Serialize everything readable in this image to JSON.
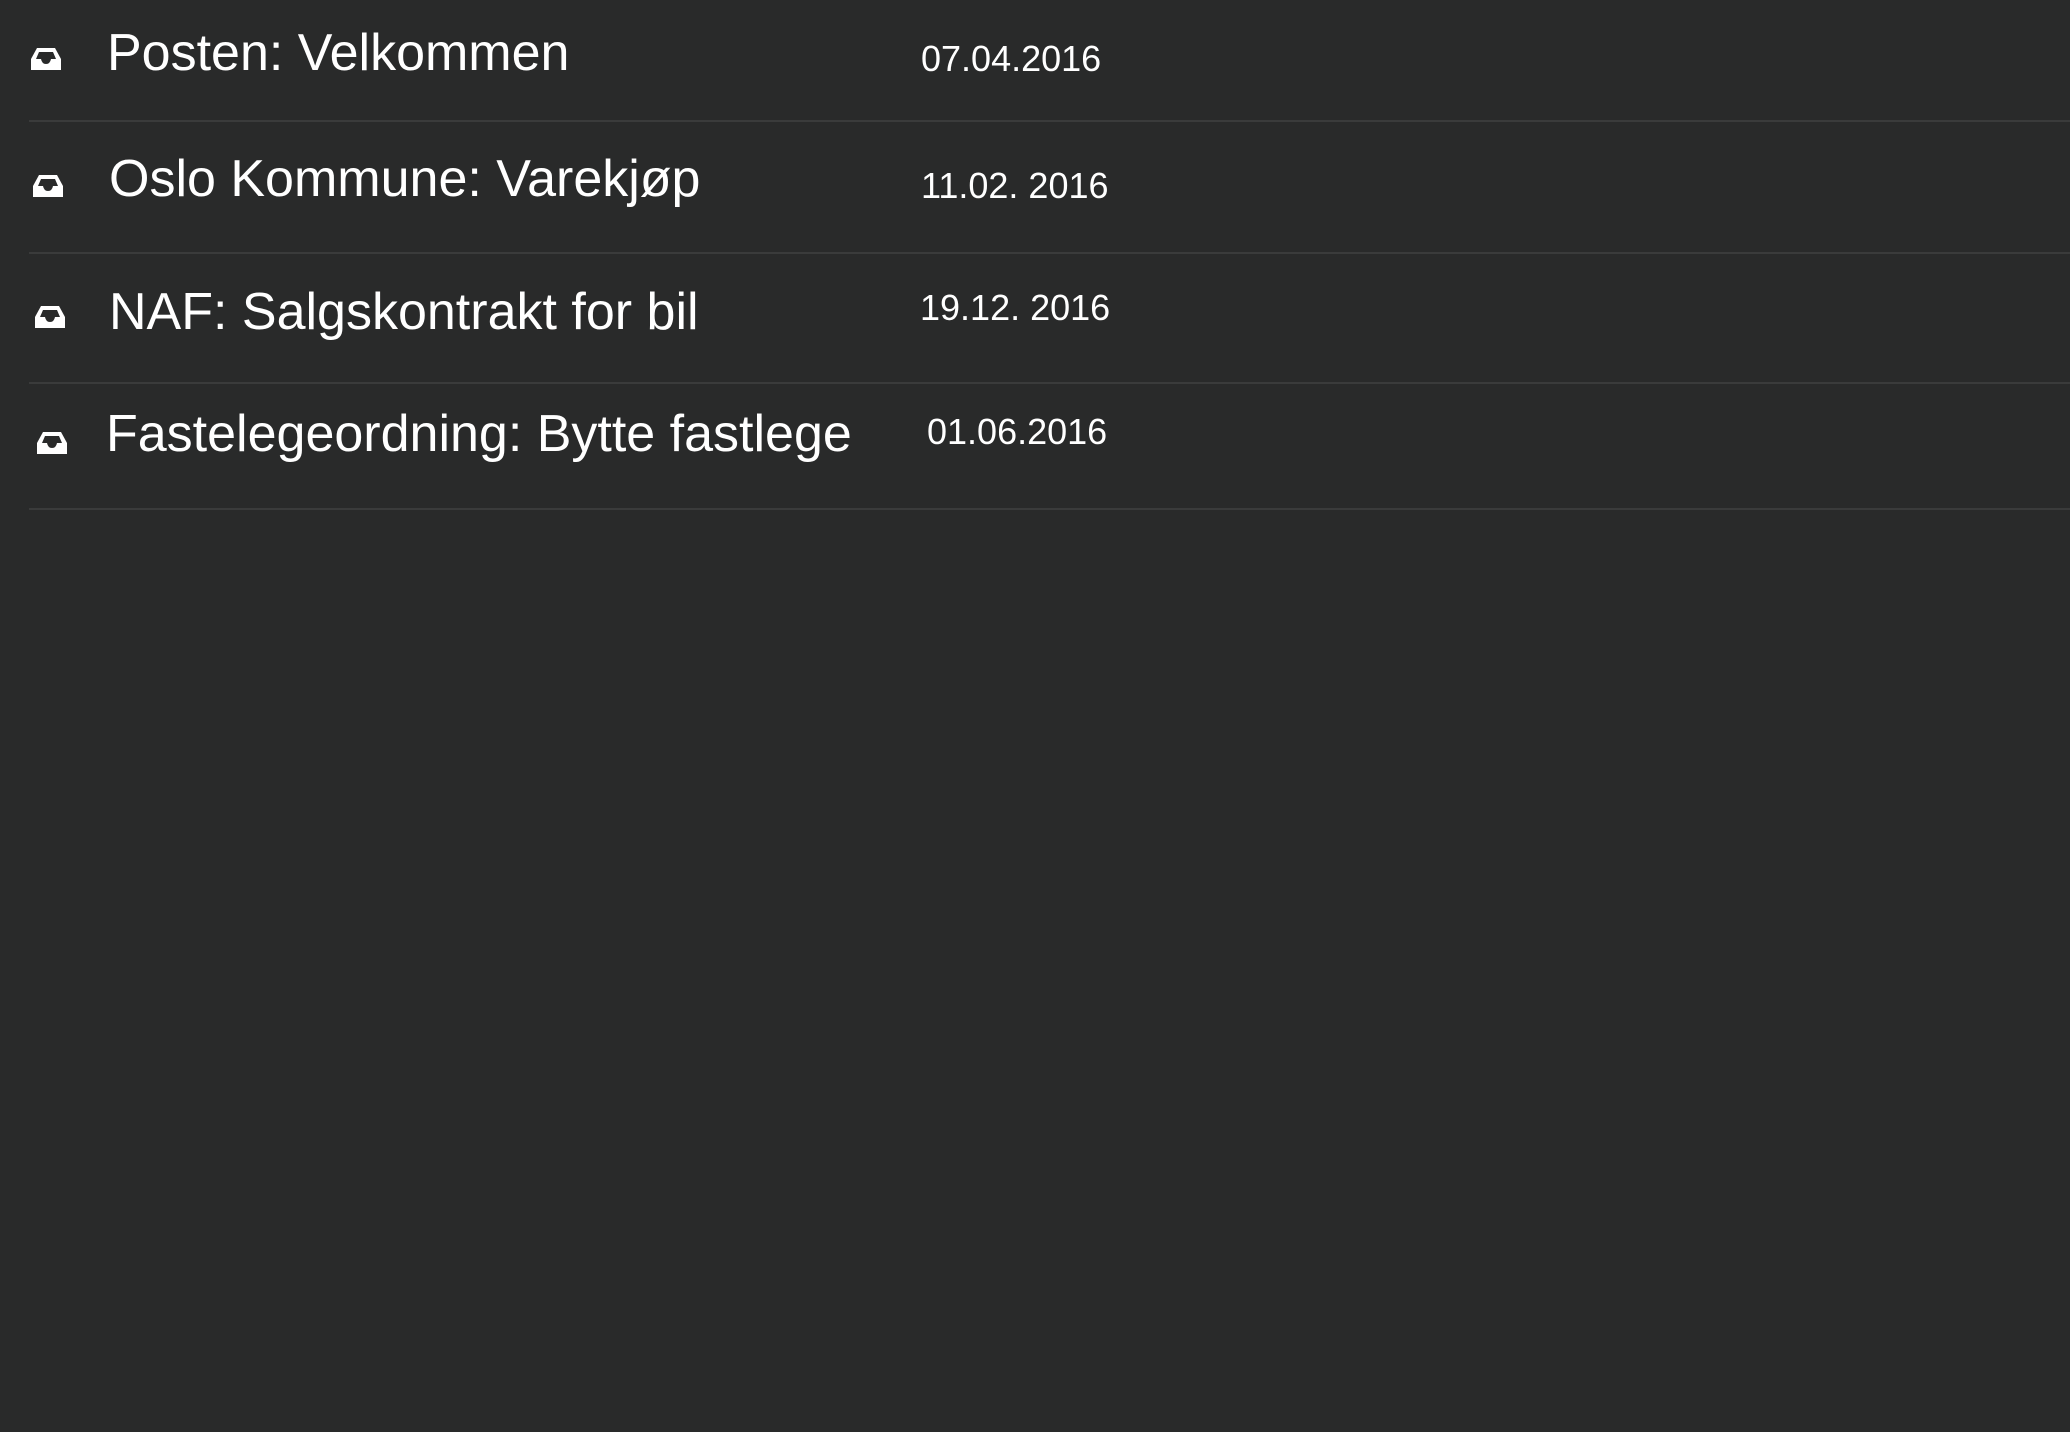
{
  "theme": {
    "background": "#292a2a",
    "text": "#ffffff",
    "divider": "#3a3b3b"
  },
  "inbox": {
    "icon": "inbox-tray-icon",
    "messages": [
      {
        "subject": "Posten: Velkommen",
        "date": "07.04.2016"
      },
      {
        "subject": "Oslo Kommune: Varekjøp",
        "date": "11.02. 2016"
      },
      {
        "subject": "NAF: Salgskontrakt for bil",
        "date": "19.12. 2016"
      },
      {
        "subject": "Fastelegeordning: Bytte fastlege",
        "date": "01.06.2016"
      }
    ]
  }
}
